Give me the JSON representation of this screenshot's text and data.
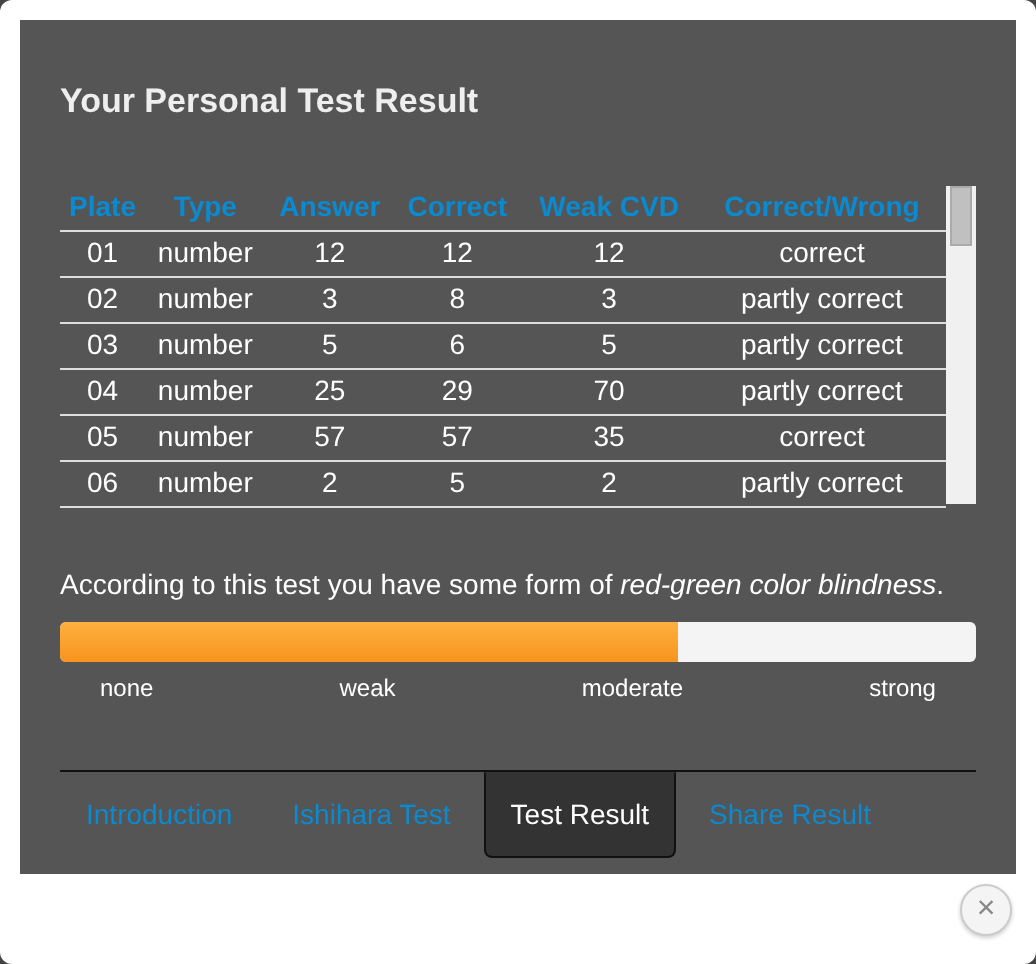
{
  "title": "Your Personal Test Result",
  "table": {
    "columns": [
      "Plate",
      "Type",
      "Answer",
      "Correct",
      "Weak CVD",
      "Correct/Wrong"
    ],
    "rows": [
      [
        "01",
        "number",
        "12",
        "12",
        "12",
        "correct"
      ],
      [
        "02",
        "number",
        "3",
        "8",
        "3",
        "partly correct"
      ],
      [
        "03",
        "number",
        "5",
        "6",
        "5",
        "partly correct"
      ],
      [
        "04",
        "number",
        "25",
        "29",
        "70",
        "partly correct"
      ],
      [
        "05",
        "number",
        "57",
        "57",
        "35",
        "correct"
      ],
      [
        "06",
        "number",
        "2",
        "5",
        "2",
        "partly correct"
      ]
    ]
  },
  "verdict": "According to this test you have some form of *red-green color blindness*.",
  "severity": {
    "level": 0.675,
    "labels": [
      "none",
      "weak",
      "moderate",
      "strong"
    ]
  },
  "tabs": [
    {
      "label": "Introduction",
      "selected": false
    },
    {
      "label": "Ishihara Test",
      "selected": false
    },
    {
      "label": "Test Result",
      "selected": true
    },
    {
      "label": "Share Result",
      "selected": false
    }
  ],
  "close_button": {
    "label": "×"
  }
}
